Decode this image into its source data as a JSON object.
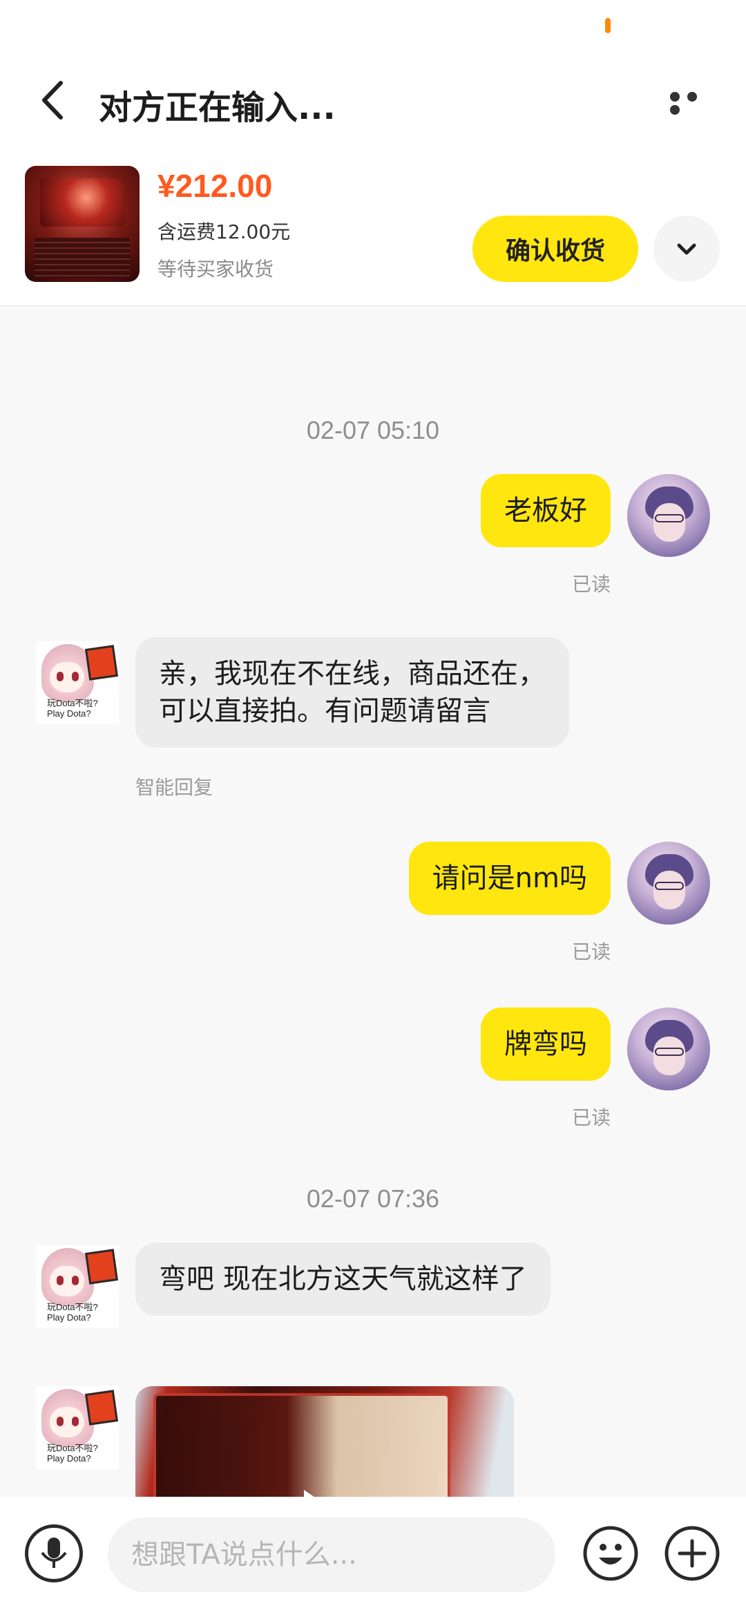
{
  "header": {
    "title": "对方正在输入..."
  },
  "product": {
    "price": "¥212.00",
    "shipping": "含运费12.00元",
    "status": "等待买家收货",
    "confirm_label": "确认收货"
  },
  "messages": {
    "ts1": "02-07 05:10",
    "m1": "老板好",
    "m1_status": "已读",
    "m2_line1": "亲，我现在不在线，商品还在，",
    "m2_line2": "可以直接拍。有问题请留言",
    "m2_tag": "智能回复",
    "m3": "请问是nm吗",
    "m3_status": "已读",
    "m4": "牌弯吗",
    "m4_status": "已读",
    "ts2": "02-07 07:36",
    "m5": "弯吧 现在北方这天气就这样了"
  },
  "avatar_caption": {
    "line1": "玩Dota不啦?",
    "line2": "Play Dota?"
  },
  "input": {
    "placeholder": "想跟TA说点什么..."
  },
  "icons": [
    "back-arrow-icon",
    "more-dots-icon",
    "chevron-down-icon",
    "microphone-icon",
    "emoji-icon",
    "plus-icon",
    "play-icon"
  ],
  "colors": {
    "accent_yellow": "#ffe60f",
    "price_orange": "#ff5a1f",
    "bubble_gray": "#ececec"
  }
}
